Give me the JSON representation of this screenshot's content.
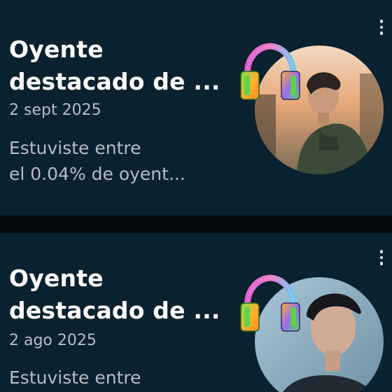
{
  "cards": [
    {
      "title_lines": [
        "Oyente",
        "destacado de ..."
      ],
      "date": "2 sept 2025",
      "description_lines": [
        "Estuviste entre",
        "el 0.04% de oyent..."
      ],
      "menu_icon": "more-vertical-icon",
      "badge_icon": "headphones-icon"
    },
    {
      "title_lines": [
        "Oyente",
        "destacado de ..."
      ],
      "date": "2 ago 2025",
      "description_lines": [
        "Estuviste entre",
        ""
      ],
      "menu_icon": "more-vertical-icon",
      "badge_icon": "headphones-icon"
    }
  ],
  "colors": {
    "card_background": "#0a2130",
    "page_background": "#050b0e",
    "title": "#ffffff",
    "secondary_text": "#b5bec3"
  }
}
